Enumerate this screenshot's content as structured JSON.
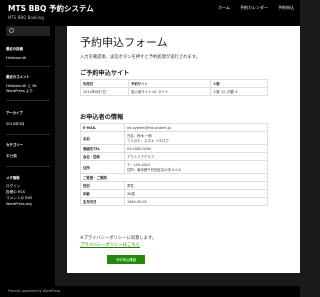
{
  "header": {
    "site_title": "MTS BBQ 予約システム",
    "site_description": "MTS BBQ Booking",
    "nav": [
      "ホーム",
      "予約カレンダー",
      "予約申込"
    ]
  },
  "sidebar": {
    "sections": [
      {
        "heading": "最近の投稿",
        "links": [
          "Helloworld!"
        ]
      },
      {
        "heading": "最近のコメント",
        "links": [
          "Helloworld! に Mr WordPress より"
        ]
      },
      {
        "heading": "アーカイブ",
        "links": [
          "2014年3月"
        ]
      },
      {
        "heading": "カテゴリー",
        "links": [
          "未分類"
        ]
      },
      {
        "heading": "メタ情報",
        "links": [
          "ログイン",
          "投稿の RSS",
          "コメントの RSS",
          "WordPress.org"
        ]
      }
    ]
  },
  "main": {
    "title": "予約申込フォーム",
    "intro": "入力を確認後、送信ボタンを押すと予約処理が実行されます。",
    "reservation": {
      "heading": "ご予約申込サイト",
      "columns": [
        "利用日",
        "予約サイト",
        "人数"
      ],
      "row": [
        "2014年6月7日",
        "炭火用サイト A1 サイト",
        "人数 12, 内数 4"
      ]
    },
    "applicant": {
      "heading": "お申込者の情報",
      "rows": [
        {
          "label": "E-MAIL",
          "value": "mt-system@mt-system.jp"
        },
        {
          "label": "名前",
          "value": "氏名：鈴木 一郎",
          "value2": "フリガナ：スズキ イチロウ"
        },
        {
          "label": "連絡先TEL",
          "value": "03-0000-0000"
        },
        {
          "label": "会社・団体",
          "value": "アウトドアクラブ"
        },
        {
          "label": "住所",
          "value": "〒：100-0001",
          "value2": "住所：東京都千代田区丸の内 0-0-0"
        }
      ],
      "subheading": "ご要望・ご質問",
      "rows2": [
        {
          "label": "性別",
          "value": "男性"
        },
        {
          "label": "年齢",
          "value": "30歳"
        },
        {
          "label": "生年月日",
          "value": "1984-05-05"
        }
      ]
    },
    "privacy_note": "※プライバシーポリシーに同意します。",
    "privacy_link": "プライバシーポリシーはこちら",
    "confirm_button": "予約申込確認"
  },
  "footer": {
    "text": "Proudly powered by WordPress"
  }
}
